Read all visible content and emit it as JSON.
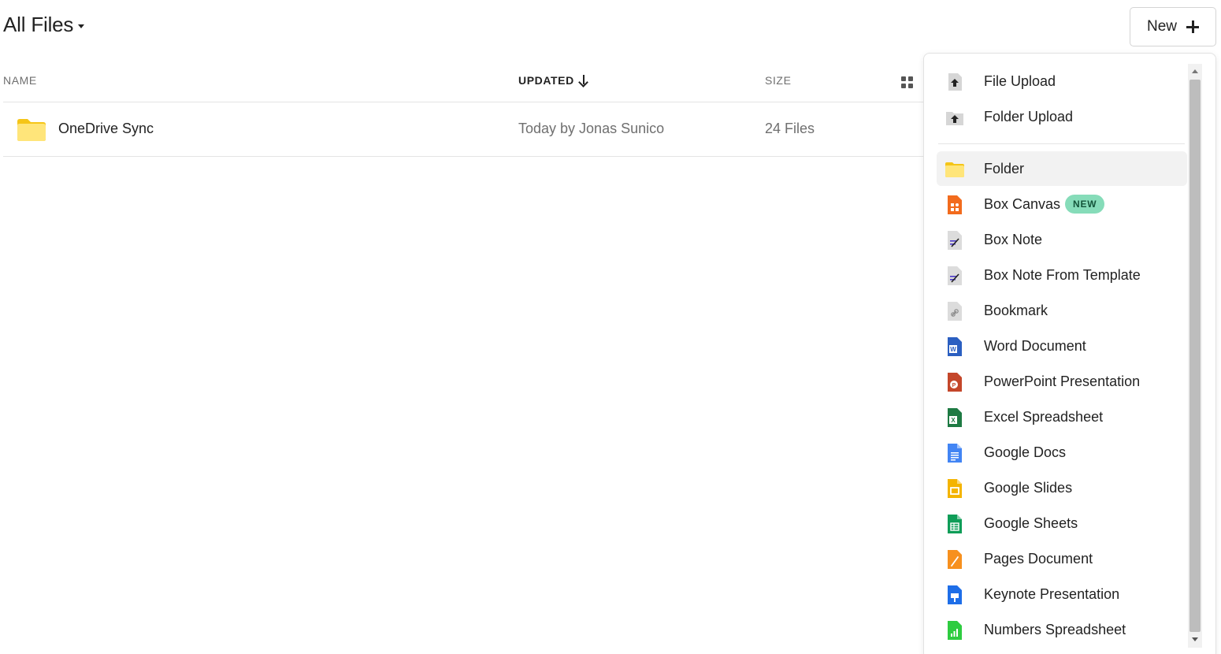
{
  "header": {
    "title": "All Files",
    "new_button_label": "New"
  },
  "columns": {
    "name": "NAME",
    "updated": "UPDATED",
    "size": "SIZE"
  },
  "rows": [
    {
      "name": "OneDrive Sync",
      "updated": "Today by Jonas Sunico",
      "size": "24 Files",
      "icon": "folder-icon"
    }
  ],
  "menu": {
    "upload_items": [
      {
        "label": "File Upload",
        "icon": "file-upload-icon"
      },
      {
        "label": "Folder Upload",
        "icon": "folder-upload-icon"
      }
    ],
    "create_items": [
      {
        "label": "Folder",
        "icon": "folder-icon"
      },
      {
        "label": "Box Canvas",
        "icon": "box-canvas-icon",
        "badge": "NEW"
      },
      {
        "label": "Box Note",
        "icon": "box-note-icon"
      },
      {
        "label": "Box Note From Template",
        "icon": "box-note-template-icon"
      },
      {
        "label": "Bookmark",
        "icon": "bookmark-icon"
      },
      {
        "label": "Word Document",
        "icon": "word-icon"
      },
      {
        "label": "PowerPoint Presentation",
        "icon": "powerpoint-icon"
      },
      {
        "label": "Excel Spreadsheet",
        "icon": "excel-icon"
      },
      {
        "label": "Google Docs",
        "icon": "google-docs-icon"
      },
      {
        "label": "Google Slides",
        "icon": "google-slides-icon"
      },
      {
        "label": "Google Sheets",
        "icon": "google-sheets-icon"
      },
      {
        "label": "Pages Document",
        "icon": "pages-icon"
      },
      {
        "label": "Keynote Presentation",
        "icon": "keynote-icon"
      },
      {
        "label": "Numbers Spreadsheet",
        "icon": "numbers-icon"
      }
    ]
  },
  "colors": {
    "folder": "#FFD84D",
    "new_badge_bg": "#86DCB9",
    "word": "#2B5FC1",
    "powerpoint": "#C4462A",
    "excel": "#1E7A43",
    "google_docs": "#4285F4",
    "google_slides": "#F4B400",
    "google_sheets": "#0F9D58",
    "pages": "#F7901E",
    "keynote": "#1E6EE8",
    "numbers": "#2ECC40"
  }
}
